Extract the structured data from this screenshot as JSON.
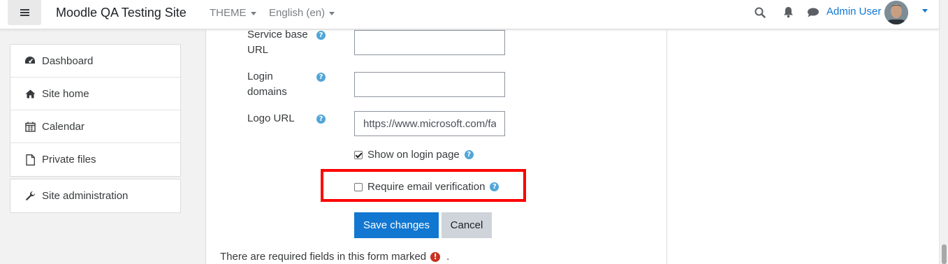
{
  "navbar": {
    "site_name": "Moodle QA Testing Site",
    "theme_menu": "THEME",
    "language_menu": "English (en)",
    "user_name": "Admin User",
    "icons": [
      "search-icon",
      "bell-icon",
      "chat-icon"
    ]
  },
  "sidebar": {
    "items": [
      {
        "label": "Dashboard",
        "icon": "dashboard-icon"
      },
      {
        "label": "Site home",
        "icon": "home-icon"
      },
      {
        "label": "Calendar",
        "icon": "calendar-icon"
      },
      {
        "label": "Private files",
        "icon": "file-icon"
      }
    ],
    "admin_item": {
      "label": "Site administration",
      "icon": "wrench-icon"
    }
  },
  "form": {
    "service_base_url": {
      "label_line1": "Service base",
      "label_line2": "URL",
      "value": ""
    },
    "login_domains": {
      "label_line1": "Login",
      "label_line2": "domains",
      "value": ""
    },
    "logo_url": {
      "label": "Logo URL",
      "value": "https://www.microsoft.com/fa"
    },
    "show_on_login_page": {
      "label": "Show on login page",
      "checked": true
    },
    "require_email_verification": {
      "label": "Require email verification",
      "checked": false
    },
    "save_label": "Save changes",
    "cancel_label": "Cancel",
    "required_note_before": "There are required fields in this form marked",
    "required_note_after": "."
  },
  "colors": {
    "primary": "#1177d1",
    "highlight": "#ff0000",
    "help_icon": "#52a6d8",
    "required_icon": "#ca3120"
  }
}
